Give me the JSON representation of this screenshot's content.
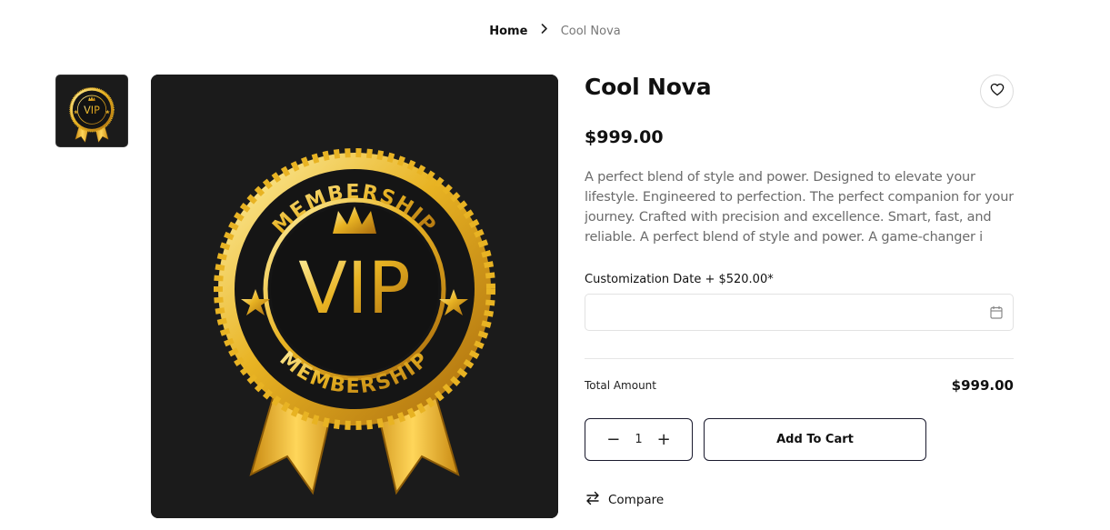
{
  "breadcrumb": {
    "home": "Home",
    "current": "Cool Nova"
  },
  "product": {
    "title": "Cool Nova",
    "price": "$999.00",
    "description": "A perfect blend of style and power. Designed to elevate your lifestyle. Engineered to perfection. The perfect companion for your journey. Crafted with precision and excellence. Smart, fast, and reliable. A perfect blend of style and power. A game-changer i",
    "image_text": {
      "vip": "VIP",
      "ring": "MEMBERSHIP"
    }
  },
  "customization": {
    "label": "Customization Date + $520.00*",
    "value": "",
    "placeholder": ""
  },
  "total": {
    "label": "Total Amount",
    "value": "$999.00"
  },
  "quantity": {
    "value": "1",
    "minus": "−",
    "plus": "+"
  },
  "buttons": {
    "add_to_cart": "Add To Cart",
    "compare": "Compare"
  },
  "icons": {
    "breadcrumb_separator": "chevron-right-icon",
    "wishlist": "heart-icon",
    "calendar": "calendar-icon",
    "compare": "compare-arrows-icon"
  },
  "colors": {
    "image_bg": "#1b1b1b",
    "gold": "#e0a521",
    "button_border": "#1a1a2e"
  }
}
